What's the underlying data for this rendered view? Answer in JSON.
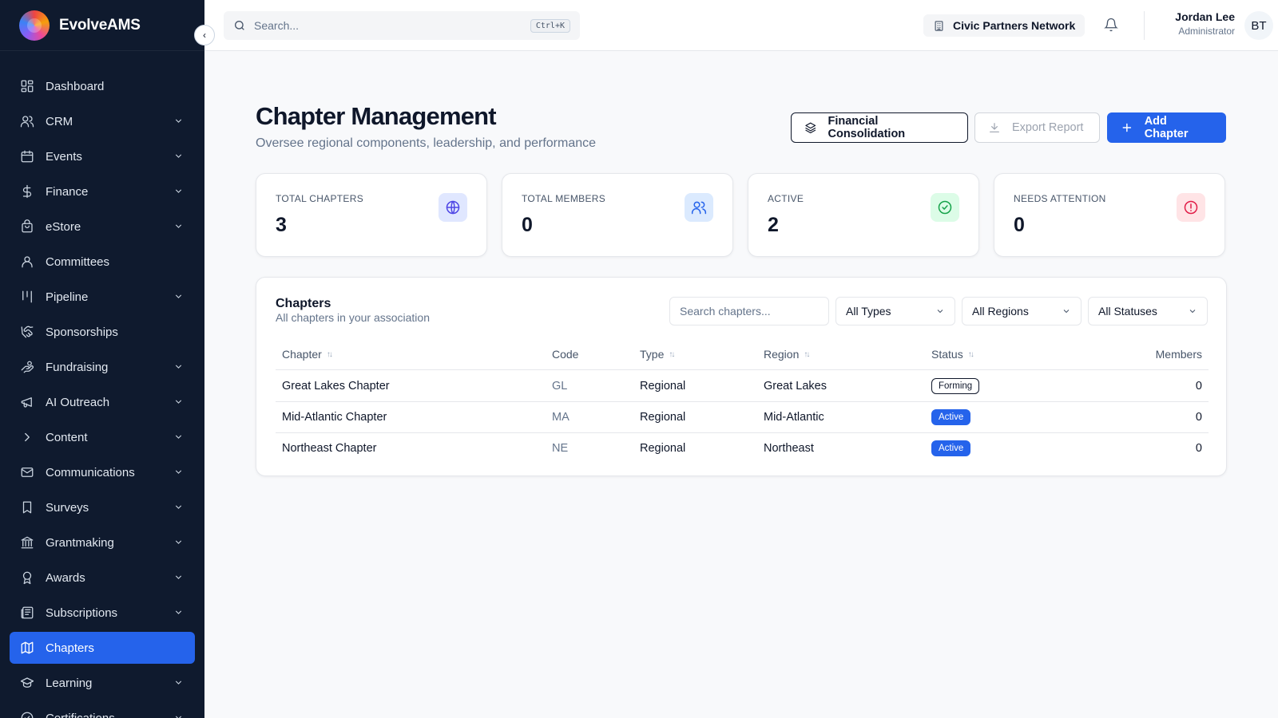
{
  "app": {
    "name": "EvolveAMS"
  },
  "sidebar": {
    "items": [
      {
        "label": "Dashboard",
        "icon": "dashboard-icon",
        "chevron": false,
        "active": false
      },
      {
        "label": "CRM",
        "icon": "users-icon",
        "chevron": true,
        "active": false
      },
      {
        "label": "Events",
        "icon": "calendar-icon",
        "chevron": true,
        "active": false
      },
      {
        "label": "Finance",
        "icon": "dollar-icon",
        "chevron": true,
        "active": false
      },
      {
        "label": "eStore",
        "icon": "shopping-bag-icon",
        "chevron": true,
        "active": false
      },
      {
        "label": "Committees",
        "icon": "user-icon",
        "chevron": false,
        "active": false
      },
      {
        "label": "Pipeline",
        "icon": "kanban-icon",
        "chevron": true,
        "active": false
      },
      {
        "label": "Sponsorships",
        "icon": "handshake-icon",
        "chevron": false,
        "active": false
      },
      {
        "label": "Fundraising",
        "icon": "hand-coins-icon",
        "chevron": true,
        "active": false
      },
      {
        "label": "AI Outreach",
        "icon": "megaphone-icon",
        "chevron": true,
        "active": false
      },
      {
        "label": "Content",
        "icon": "chevron-right-icon",
        "chevron": true,
        "active": false
      },
      {
        "label": "Communications",
        "icon": "mail-icon",
        "chevron": true,
        "active": false
      },
      {
        "label": "Surveys",
        "icon": "bookmark-icon",
        "chevron": true,
        "active": false
      },
      {
        "label": "Grantmaking",
        "icon": "landmark-icon",
        "chevron": true,
        "active": false
      },
      {
        "label": "Awards",
        "icon": "award-icon",
        "chevron": true,
        "active": false
      },
      {
        "label": "Subscriptions",
        "icon": "newspaper-icon",
        "chevron": true,
        "active": false
      },
      {
        "label": "Chapters",
        "icon": "map-icon",
        "chevron": false,
        "active": true
      },
      {
        "label": "Learning",
        "icon": "graduation-cap-icon",
        "chevron": true,
        "active": false
      },
      {
        "label": "Certifications",
        "icon": "badge-check-icon",
        "chevron": true,
        "active": false
      }
    ]
  },
  "topbar": {
    "search_placeholder": "Search...",
    "shortcut": "Ctrl+K",
    "organization": "Civic Partners Network",
    "user_name": "Jordan Lee",
    "user_role": "Administrator",
    "avatar_initials": "BT"
  },
  "page": {
    "title": "Chapter Management",
    "subtitle": "Oversee regional components, leadership, and performance",
    "buttons": {
      "financial": "Financial Consolidation",
      "export": "Export Report",
      "add": "Add Chapter"
    }
  },
  "stats": [
    {
      "label": "TOTAL CHAPTERS",
      "value": "3",
      "icon": "globe-icon",
      "icon_color": "#4f46e5",
      "icon_bg": "#e0e7ff"
    },
    {
      "label": "TOTAL MEMBERS",
      "value": "0",
      "icon": "users-icon",
      "icon_color": "#2563eb",
      "icon_bg": "#dbeafe"
    },
    {
      "label": "ACTIVE",
      "value": "2",
      "icon": "check-circle-icon",
      "icon_color": "#16a34a",
      "icon_bg": "#dcfce7"
    },
    {
      "label": "NEEDS ATTENTION",
      "value": "0",
      "icon": "alert-circle-icon",
      "icon_color": "#e11d48",
      "icon_bg": "#ffe4e6"
    }
  ],
  "chapters": {
    "title": "Chapters",
    "subtitle": "All chapters in your association",
    "search_placeholder": "Search chapters...",
    "filters": {
      "type": "All Types",
      "region": "All Regions",
      "status": "All Statuses"
    },
    "columns": [
      "Chapter",
      "Code",
      "Type",
      "Region",
      "Status",
      "Members"
    ],
    "rows": [
      {
        "name": "Great Lakes Chapter",
        "code": "GL",
        "type": "Regional",
        "region": "Great Lakes",
        "status": "Forming",
        "members": "0"
      },
      {
        "name": "Mid-Atlantic Chapter",
        "code": "MA",
        "type": "Regional",
        "region": "Mid-Atlantic",
        "status": "Active",
        "members": "0"
      },
      {
        "name": "Northeast Chapter",
        "code": "NE",
        "type": "Regional",
        "region": "Northeast",
        "status": "Active",
        "members": "0"
      }
    ]
  }
}
